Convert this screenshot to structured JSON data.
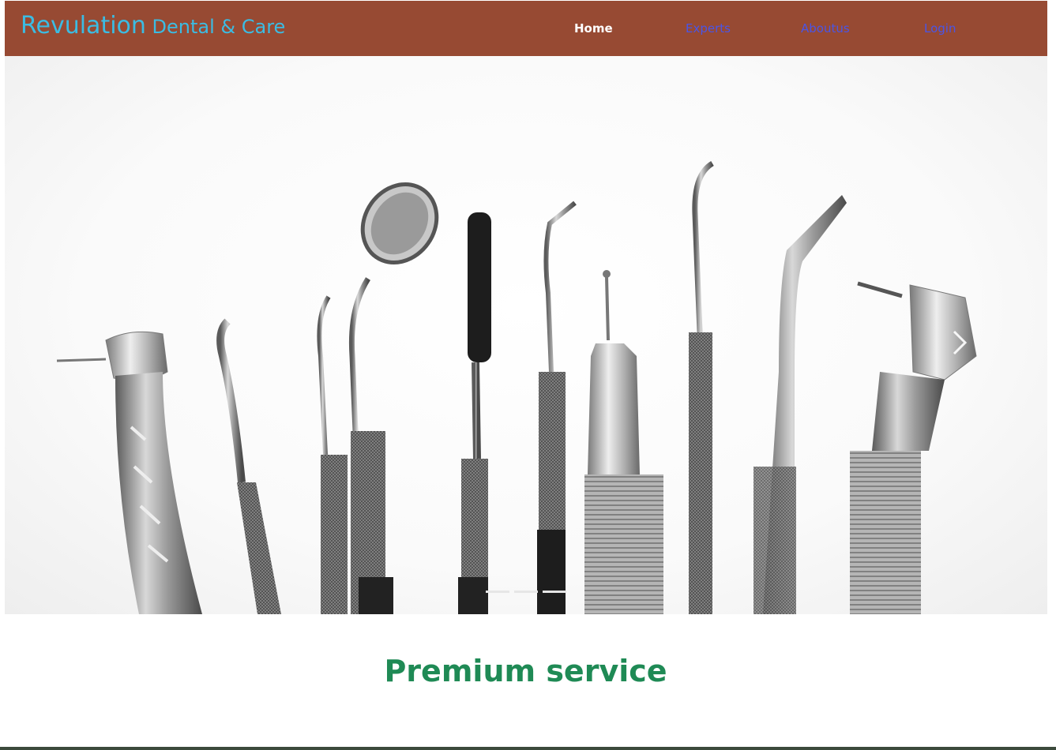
{
  "brand": {
    "part1": "Revulation",
    "part2": " Dental & Care"
  },
  "nav": {
    "home": "Home",
    "experts": "Experts",
    "about": "Aboutus",
    "login": "Login"
  },
  "colors": {
    "navbar_bg": "#974a33",
    "brand_text": "#3bbce3",
    "active_link": "#ffffff",
    "inactive_link": "#4a55e6",
    "headline": "#1f8a55"
  },
  "carousel": {
    "image_alt": "Dental instruments",
    "next_icon": "chevron-right-icon",
    "slide_count": 3,
    "active_slide": 2
  },
  "section": {
    "headline": "Premium service"
  }
}
